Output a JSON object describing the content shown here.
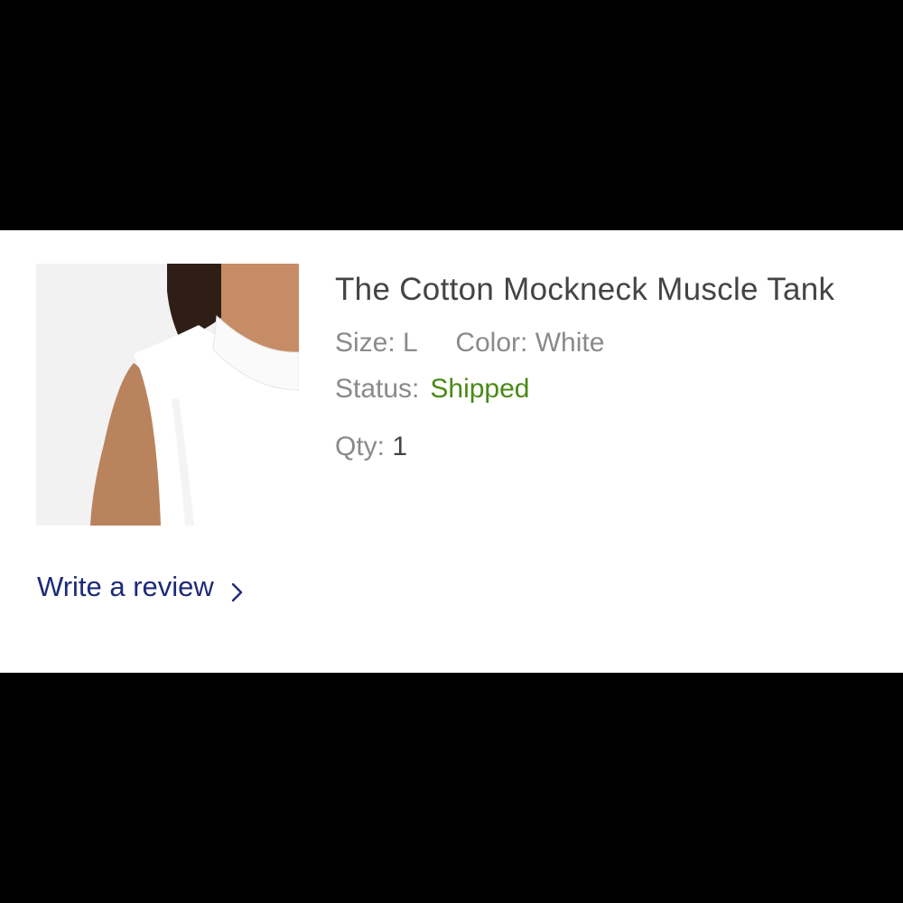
{
  "item": {
    "image_alt": "Product photo",
    "title": "The Cotton Mockneck Muscle Tank",
    "size_label": "Size:",
    "size_value": "L",
    "color_label": "Color:",
    "color_value": "White",
    "status_label": "Status:",
    "status_value": "Shipped",
    "qty_label": "Qty:",
    "qty_value": "1"
  },
  "actions": {
    "write_review_label": "Write a review",
    "write_review_icon": "chevron-right-icon"
  },
  "colors": {
    "status_shipped": "#4a8a17",
    "link": "#1c2a78",
    "title": "#444444",
    "meta": "#8a8a8a",
    "backdrop": "#000000",
    "card": "#ffffff"
  }
}
